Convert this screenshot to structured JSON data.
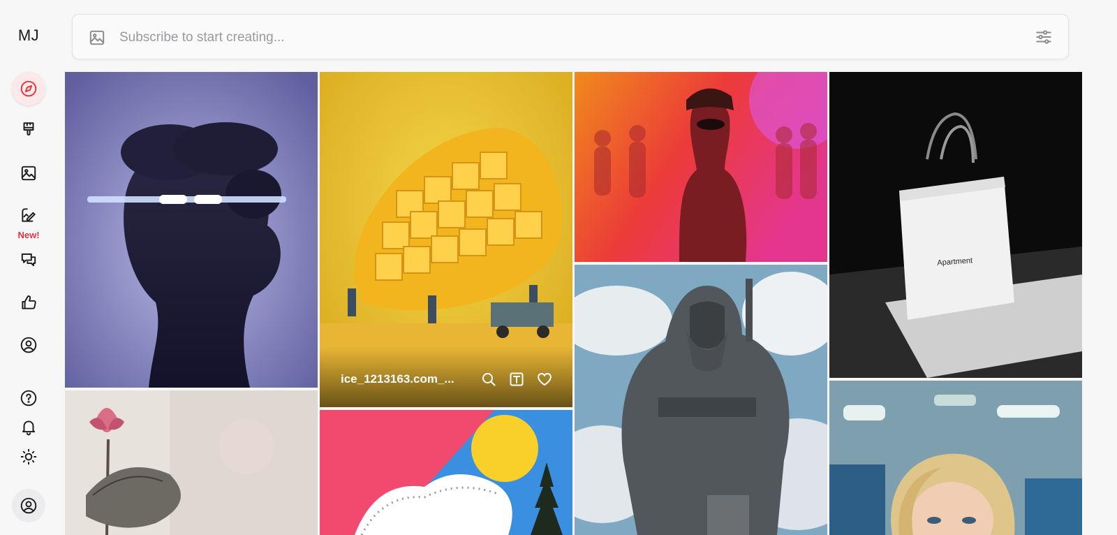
{
  "app": {
    "logo": "MJ"
  },
  "sidebar": {
    "items": [
      {
        "name": "explore",
        "icon": "compass-icon",
        "active": true
      },
      {
        "name": "create",
        "icon": "paintbrush-icon"
      },
      {
        "name": "organize",
        "icon": "image-icon"
      },
      {
        "name": "edit",
        "icon": "edit-image-icon",
        "badge": "New!"
      },
      {
        "name": "chat",
        "icon": "chat-icon"
      },
      {
        "name": "rank",
        "icon": "thumbs-up-icon"
      },
      {
        "name": "personalize",
        "icon": "user-circle-icon"
      }
    ],
    "bottom": [
      {
        "name": "help",
        "icon": "help-icon"
      },
      {
        "name": "notifications",
        "icon": "bell-icon"
      },
      {
        "name": "theme",
        "icon": "sun-icon"
      },
      {
        "name": "profile",
        "icon": "avatar-icon"
      }
    ]
  },
  "search": {
    "placeholder": "Subscribe to start creating..."
  },
  "gallery": {
    "hover_tile": {
      "user": "ice_1213163.com_...",
      "actions": [
        "search-icon",
        "text-prompt-icon",
        "heart-icon"
      ]
    },
    "tiles": [
      {
        "name": "abstract-head"
      },
      {
        "name": "mango-miniature"
      },
      {
        "name": "sunglasses-woman"
      },
      {
        "name": "shopping-bag",
        "caption": "Apartment"
      },
      {
        "name": "lotus-painting"
      },
      {
        "name": "colorful-geometric"
      },
      {
        "name": "stone-warrior-statue"
      },
      {
        "name": "blonde-woman-office"
      }
    ]
  },
  "colors": {
    "accent": "#e8333c",
    "background": "#f7f7f8"
  }
}
